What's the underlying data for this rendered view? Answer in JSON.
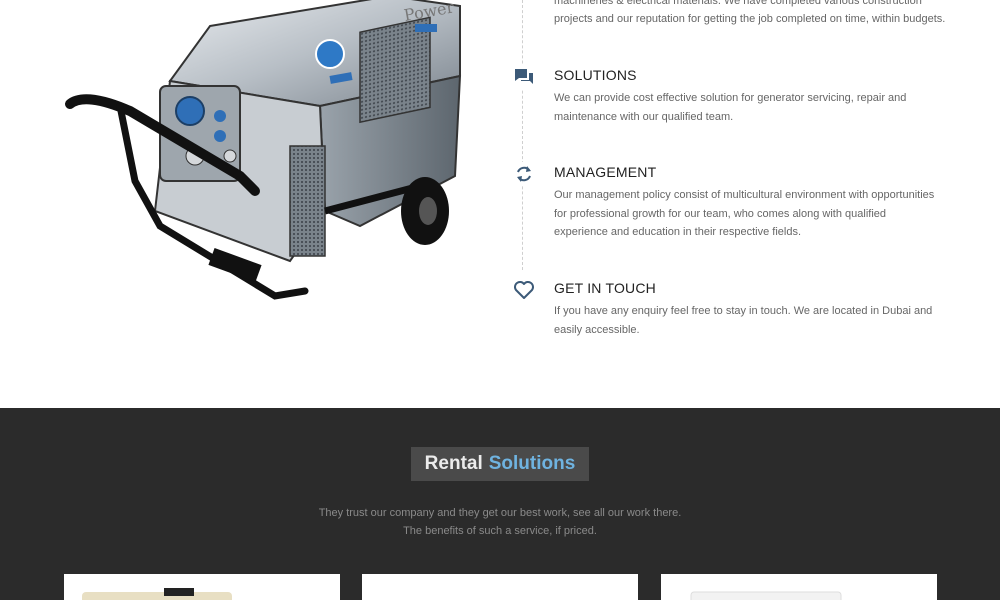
{
  "intro": {
    "line1": "machineries & electrical materials. We have completed various construction",
    "line2": "projects and our reputation for getting the job completed on time, within budgets."
  },
  "features": [
    {
      "icon": "chat-icon",
      "title": "SOLUTIONS",
      "text": "We can provide cost effective solution for generator servicing, repair and maintenance with our qualified team."
    },
    {
      "icon": "refresh-icon",
      "title": "MANAGEMENT",
      "text": "Our management policy consist of multicultural environment with opportunities for professional growth for our team, who comes along with qualified experience and education in their respective fields."
    },
    {
      "icon": "heart-icon",
      "title": "GET IN TOUCH",
      "text": "If you have any enquiry feel free to stay in touch. We are located in Dubai and easily accessible."
    }
  ],
  "rental": {
    "title_part1": "Rental",
    "title_part2": "Solutions",
    "tagline1": "They trust our company and they get our best work, see all our work there.",
    "tagline2": "The benefits of such a service, if priced."
  },
  "generator_label": "Power",
  "colors": {
    "dark_bg": "#2b2b2b",
    "title_box": "#4a4a4a",
    "accent_blue": "#6fb3e0",
    "icon_color": "#3c5a78"
  }
}
